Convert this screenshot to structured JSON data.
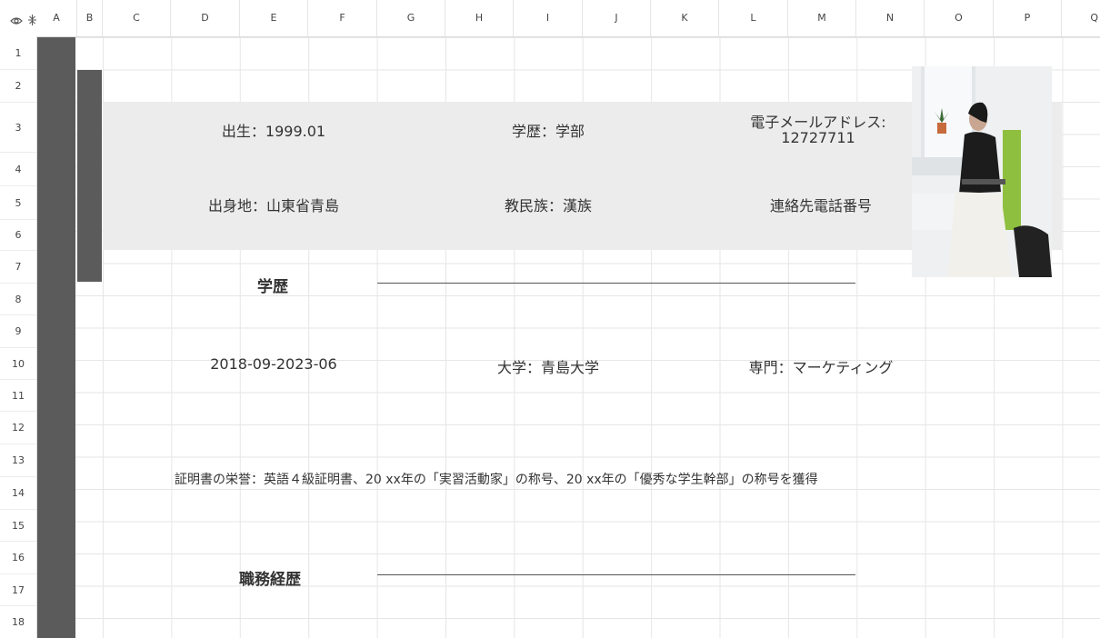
{
  "columns": [
    "A",
    "B",
    "C",
    "D",
    "E",
    "F",
    "G",
    "H",
    "I",
    "J",
    "K",
    "L",
    "M",
    "N",
    "O",
    "P",
    "Q"
  ],
  "rows": [
    "1",
    "2",
    "3",
    "4",
    "5",
    "6",
    "7",
    "8",
    "9",
    "10",
    "11",
    "12",
    "13",
    "14",
    "15",
    "16",
    "17",
    "18"
  ],
  "resume": {
    "birth": "出生：1999.01",
    "education_level": "学歴：学部",
    "email_label": "電子メールアドレス:",
    "email_value": "12727711",
    "hometown": "出身地：山東省青島",
    "ethnicity": "教民族：漢族",
    "phone_label": "連絡先電話番号",
    "education_heading": "学歴",
    "edu_period": "2018-09-2023-06",
    "edu_university": "大学：青島大学",
    "edu_major": "専門：マーケティング",
    "certificates": "証明書の栄誉：英語４級証明書、20 xx年の「実習活動家」の称号、20 xx年の「優秀な学生幹部」の称号を獲得",
    "work_heading": "職務経歴"
  },
  "icons": {
    "corner_view": "eye-icon",
    "corner_freeze": "freeze-panes-icon"
  },
  "colors": {
    "dark_column": "#5b5b5b",
    "info_band": "#ececec",
    "grid_line": "#e6e6e6"
  }
}
